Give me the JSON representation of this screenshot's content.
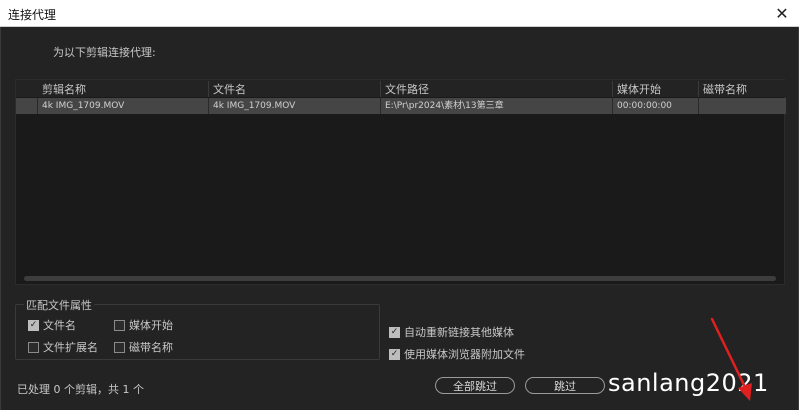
{
  "window": {
    "title": "连接代理",
    "close_glyph": "✕"
  },
  "instruction": "为以下剪辑连接代理:",
  "table": {
    "headers": [
      "剪辑名称",
      "文件名",
      "文件路径",
      "媒体开始",
      "磁带名称"
    ],
    "rows": [
      [
        "4k IMG_1709.MOV",
        "4k IMG_1709.MOV",
        "E:\\Pr\\pr2024\\素材\\13第三章",
        "00:00:00:00",
        ""
      ]
    ]
  },
  "match_group": {
    "title": "匹配文件属性",
    "options": [
      {
        "label": "文件名",
        "checked": true
      },
      {
        "label": "媒体开始",
        "checked": false
      },
      {
        "label": "文件扩展名",
        "checked": false
      },
      {
        "label": "磁带名称",
        "checked": false
      }
    ]
  },
  "right_options": [
    {
      "label": "自动重新链接其他媒体",
      "checked": true
    },
    {
      "label": "使用媒体浏览器附加文件",
      "checked": true
    }
  ],
  "status": "已处理 0 个剪辑，共 1 个",
  "buttons": {
    "skip_all": "全部跳过",
    "skip": "跳过"
  },
  "watermark": "sanlang2021",
  "colors": {
    "background": "#232323",
    "table_bg": "#1a1a1a",
    "selected_row": "#454545",
    "arrow": "#e02020"
  }
}
